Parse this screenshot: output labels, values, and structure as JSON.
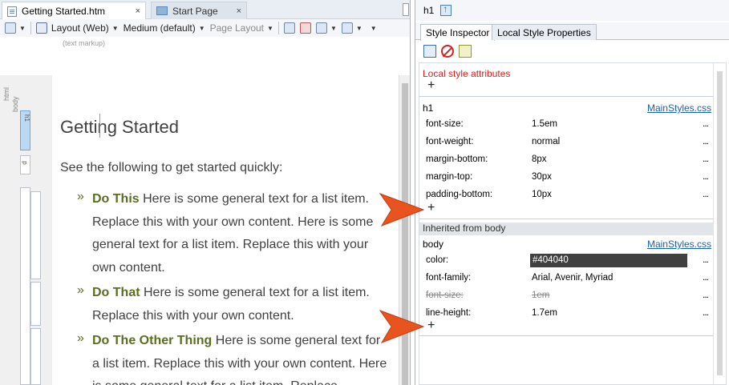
{
  "editor": {
    "tabs": [
      {
        "label": "Getting Started.htm",
        "close": "×"
      },
      {
        "label": "Start Page",
        "close": "×"
      }
    ],
    "toolbar": {
      "layout": "Layout (Web)",
      "medium": "Medium (default)",
      "page_layout": "Page Layout"
    },
    "text_markup": "(text markup)",
    "structure_labels": {
      "html": "html",
      "body": "body",
      "h1": "h1",
      "p": "p"
    },
    "document": {
      "heading": "Getting Started",
      "intro": "See the following to get started quickly:",
      "bullet_glyph": "»",
      "items": [
        {
          "bold": "Do This",
          "text": " Here is some general text for a list item. Replace this with your own content. Here is some general text for a list item. Replace this with your own content."
        },
        {
          "bold": "Do That",
          "text": " Here is some general text for a list item. Replace this with your own content."
        },
        {
          "bold": "Do The Other Thing",
          "text": " Here is some general text for a list item. Replace this with your own content. Here is some general text for a list item. Replace"
        }
      ]
    }
  },
  "inspector": {
    "element": "h1",
    "tabs": [
      "Style Inspector",
      "Local Style Properties"
    ],
    "local_title": "Local style attributes",
    "plus": "+",
    "more": "...",
    "h1_section": {
      "selector": "h1",
      "source": "MainStyles.css",
      "properties": [
        {
          "name": "font-size:",
          "value": "1.5em"
        },
        {
          "name": "font-weight:",
          "value": "normal"
        },
        {
          "name": "margin-bottom:",
          "value": "8px"
        },
        {
          "name": "margin-top:",
          "value": "30px"
        },
        {
          "name": "padding-bottom:",
          "value": "10px"
        }
      ]
    },
    "inherited_title": "Inherited from body",
    "body_section": {
      "selector": "body",
      "source": "MainStyles.css",
      "properties": [
        {
          "name": "color:",
          "value": "#404040"
        },
        {
          "name": "font-family:",
          "value": "Arial, Avenir, Myriad"
        },
        {
          "name": "font-size:",
          "value": "1em"
        },
        {
          "name": "line-height:",
          "value": "1.7em"
        }
      ]
    }
  },
  "colors": {
    "accent_red": "#d41f1f",
    "link_blue": "#1a5fb4",
    "heading_text": "#404040",
    "bullet_green": "#5a6e1f",
    "callout_orange": "#e8531e"
  }
}
